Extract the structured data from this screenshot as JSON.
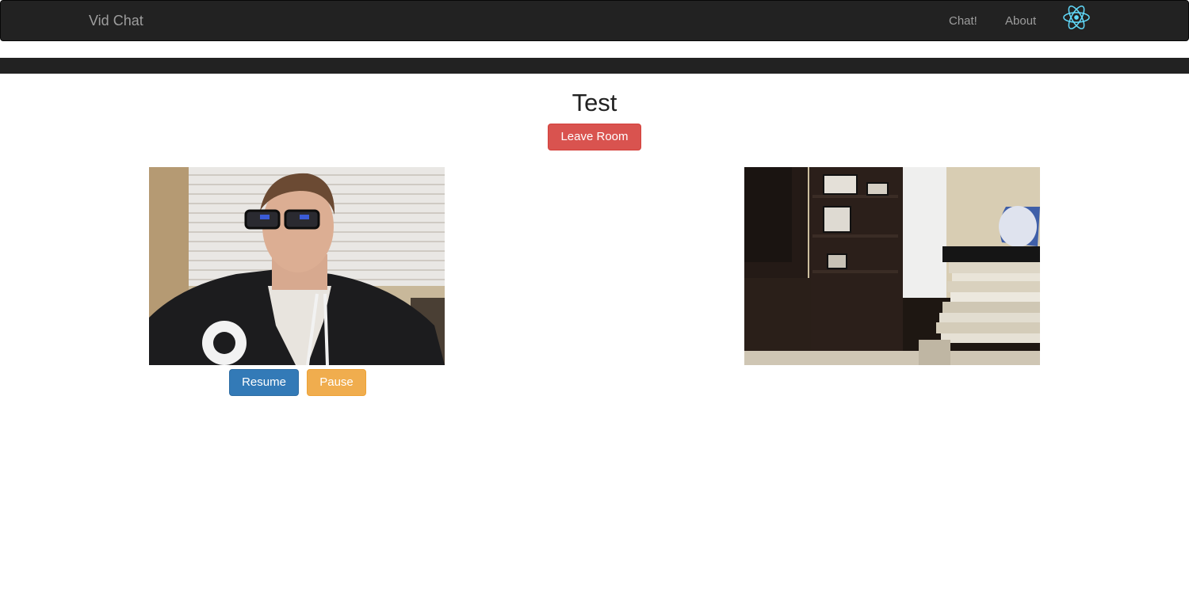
{
  "navbar": {
    "brand": "Vid Chat",
    "links": [
      {
        "label": "Chat!"
      },
      {
        "label": "About"
      }
    ],
    "logo_icon": "react-logo-icon",
    "logo_color": "#61dafb",
    "background": "#222222"
  },
  "room": {
    "title": "Test",
    "leave_label": "Leave Room"
  },
  "local_video": {
    "controls": {
      "resume_label": "Resume",
      "pause_label": "Pause"
    }
  },
  "colors": {
    "danger": "#d9534f",
    "primary": "#337ab7",
    "warning": "#f0ad4e"
  }
}
